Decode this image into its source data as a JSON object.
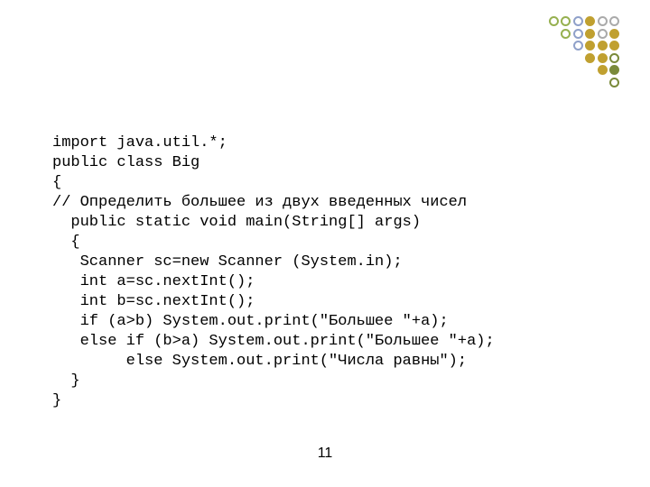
{
  "code": {
    "l1": "import java.util.*;",
    "l2": "public class Big",
    "l3": "{",
    "l4": "// Определить большее из двух введенных чисел",
    "l5": "  public static void main(String[] args)",
    "l6": "  {",
    "l7": "   Scanner sc=new Scanner (System.in);",
    "l8": "   int a=sc.nextInt();",
    "l9": "   int b=sc.nextInt();",
    "l10": "   if (a>b) System.out.print(\"Большее \"+a);",
    "l11": "   else if (b>a) System.out.print(\"Большее \"+a);",
    "l12": "        else System.out.print(\"Числа равны\");",
    "l13": "  }",
    "l14": "}"
  },
  "page_number": "11"
}
